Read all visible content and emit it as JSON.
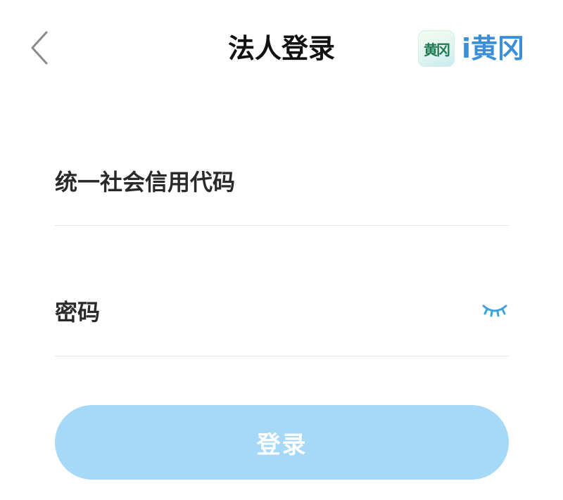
{
  "header": {
    "title": "法人登录",
    "back_icon": "chevron-left-icon",
    "brand": {
      "logo_text": "黄冈",
      "name": "i黄冈",
      "color": "#3c8fd6"
    }
  },
  "form": {
    "credit_code": {
      "placeholder": "统一社会信用代码",
      "value": ""
    },
    "password": {
      "placeholder": "密码",
      "value": "",
      "toggle_icon": "eye-closed-icon"
    }
  },
  "login_button": {
    "label": "登录",
    "color": "#a6d9f8",
    "state": "disabled"
  },
  "colors": {
    "accent": "#3ca2dc",
    "divider": "#e6e6e6"
  }
}
